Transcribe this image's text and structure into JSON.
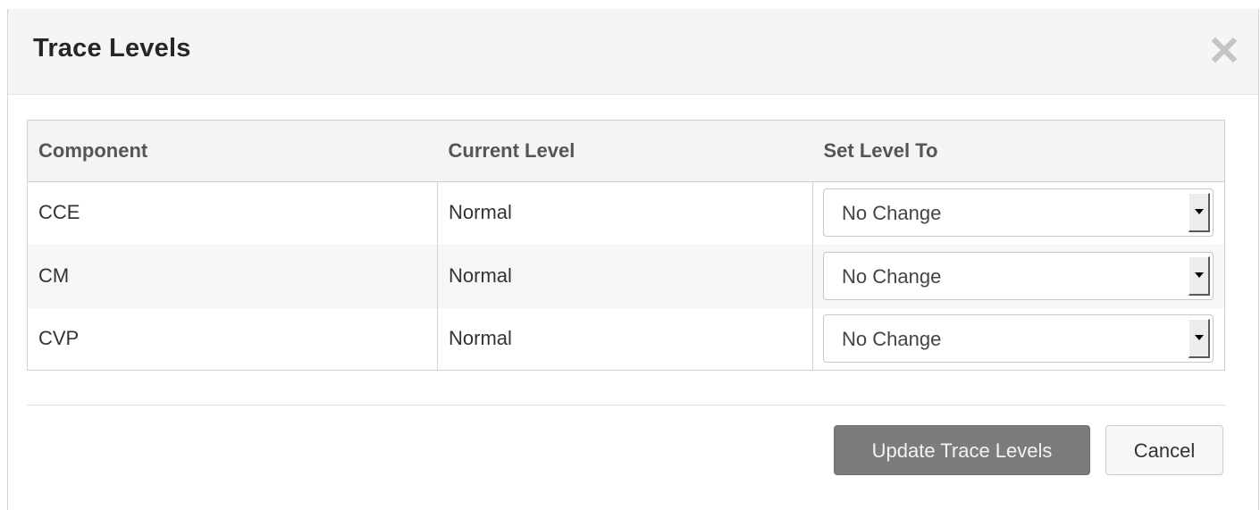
{
  "dialog": {
    "title": "Trace Levels",
    "close_icon": "close-icon"
  },
  "table": {
    "headers": {
      "component": "Component",
      "current_level": "Current Level",
      "set_level_to": "Set Level To"
    },
    "rows": [
      {
        "component": "CCE",
        "current_level": "Normal",
        "set_level_to": "No Change"
      },
      {
        "component": "CM",
        "current_level": "Normal",
        "set_level_to": "No Change"
      },
      {
        "component": "CVP",
        "current_level": "Normal",
        "set_level_to": "No Change"
      }
    ]
  },
  "footer": {
    "update_label": "Update Trace Levels",
    "cancel_label": "Cancel"
  },
  "colors": {
    "header_background": "#f5f5f5",
    "table_header_background": "#f6f3f6",
    "primary_button": "#7c7c7c",
    "close_icon": "#c4c4c4"
  }
}
